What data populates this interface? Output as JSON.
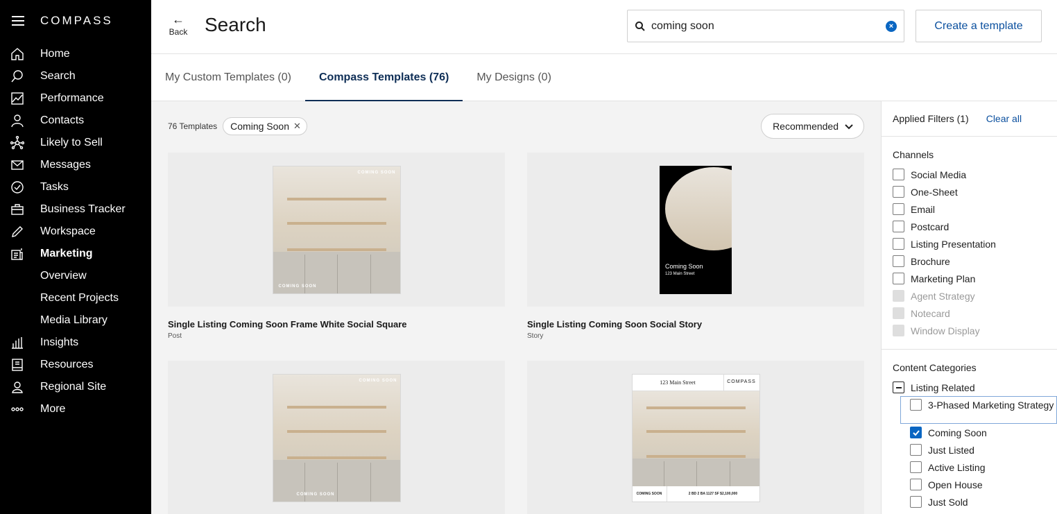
{
  "sidebar": {
    "logo": "COMPASS",
    "items": [
      {
        "label": "Home",
        "icon": "home-icon"
      },
      {
        "label": "Search",
        "icon": "search-icon"
      },
      {
        "label": "Performance",
        "icon": "chart-icon"
      },
      {
        "label": "Contacts",
        "icon": "person-icon"
      },
      {
        "label": "Likely to Sell",
        "icon": "network-icon"
      },
      {
        "label": "Messages",
        "icon": "envelope-icon"
      },
      {
        "label": "Tasks",
        "icon": "check-circle-icon"
      },
      {
        "label": "Business Tracker",
        "icon": "briefcase-icon"
      },
      {
        "label": "Workspace",
        "icon": "pencil-icon"
      },
      {
        "label": "Marketing",
        "icon": "marketing-icon"
      }
    ],
    "sub_items": [
      "Overview",
      "Recent Projects",
      "Media Library"
    ],
    "bottom_items": [
      {
        "label": "Insights",
        "icon": "bar-chart-icon"
      },
      {
        "label": "Resources",
        "icon": "book-icon"
      },
      {
        "label": "Regional Site",
        "icon": "user-pin-icon"
      },
      {
        "label": "More",
        "icon": "more-dots-icon"
      }
    ]
  },
  "header": {
    "back_label": "Back",
    "title": "Search",
    "search_value": "coming soon",
    "create_label": "Create a template"
  },
  "tabs": [
    {
      "label": "My Custom Templates (0)",
      "active": false
    },
    {
      "label": "Compass Templates (76)",
      "active": true
    },
    {
      "label": "My Designs (0)",
      "active": false
    }
  ],
  "toolbar": {
    "count": "76 Templates",
    "chip": "Coming Soon",
    "sort": "Recommended"
  },
  "templates": [
    {
      "name": "Single Listing Coming Soon Frame White Social Square",
      "type": "Post",
      "thumb_text": "COMING SOON"
    },
    {
      "name": "Single Listing Coming Soon Social Story",
      "type": "Story",
      "thumb_text": "Coming Soon",
      "thumb_sub": "123 Main Street"
    },
    {
      "name": "",
      "type": "",
      "thumb_text": "COMING SOON"
    },
    {
      "name": "",
      "type": "",
      "thumb_top_left": "123 Main Street",
      "thumb_top_right": "COMPASS",
      "thumb_bottom_left": "COMING SOON",
      "thumb_bottom_right": "2 BD   2 BA   1127 SF   $2,100,000"
    }
  ],
  "filters": {
    "applied_label": "Applied Filters (1)",
    "clear_label": "Clear all",
    "channels_title": "Channels",
    "channels": [
      {
        "label": "Social Media",
        "disabled": false
      },
      {
        "label": "One-Sheet",
        "disabled": false
      },
      {
        "label": "Email",
        "disabled": false
      },
      {
        "label": "Postcard",
        "disabled": false
      },
      {
        "label": "Listing Presentation",
        "disabled": false
      },
      {
        "label": "Brochure",
        "disabled": false
      },
      {
        "label": "Marketing Plan",
        "disabled": false
      },
      {
        "label": "Agent Strategy",
        "disabled": true
      },
      {
        "label": "Notecard",
        "disabled": true
      },
      {
        "label": "Window Display",
        "disabled": true
      }
    ],
    "categories_title": "Content Categories",
    "parent_category": "Listing Related",
    "categories": [
      {
        "label": "3-Phased Marketing Strategy",
        "checked": false
      },
      {
        "label": "Coming Soon",
        "checked": true
      },
      {
        "label": "Just Listed",
        "checked": false
      },
      {
        "label": "Active Listing",
        "checked": false
      },
      {
        "label": "Open House",
        "checked": false
      },
      {
        "label": "Just Sold",
        "checked": false
      }
    ]
  }
}
